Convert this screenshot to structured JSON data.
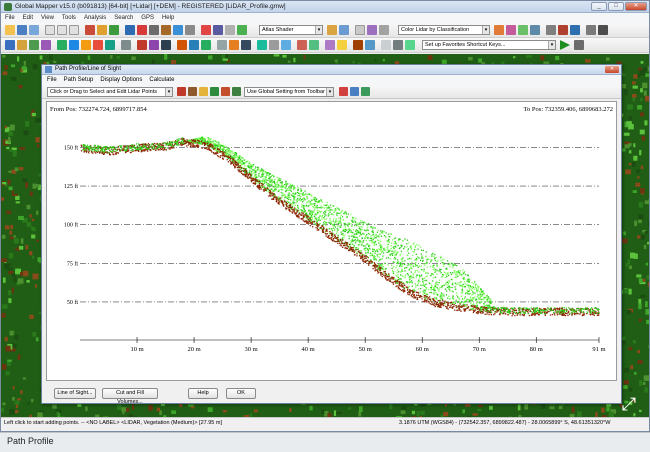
{
  "app": {
    "title": "Global Mapper v15.0 (b091813) [64-bit] [+Lidar] [+DEM] - REGISTERED [LiDAR_Profile.gmw]",
    "menu": [
      "File",
      "Edit",
      "View",
      "Tools",
      "Analysis",
      "Search",
      "GPS",
      "Help"
    ],
    "toolbar": {
      "shader_combo": "Atlas Shader",
      "color_combo": "Color Lidar by Classification",
      "favorites_combo": "Set up Favorites Shortcut Keys..."
    },
    "statusbar": {
      "left": "Left click to start adding points. -- <NO LABEL> <LIDAR, Vegetation (Medium)> [27.95 m]",
      "right": "3.1876  UTM (WGS84) - (732542.357, 6899822.487) - 28.0065899° S, 48.61351320°W"
    },
    "bottom_label": "Path Profile"
  },
  "dialog": {
    "title": "Path Profile/Line of Sight",
    "menu": [
      "File",
      "Path Setup",
      "Display Options",
      "Calculate"
    ],
    "tool_combo": "Click or Drag to Select and Edit Lidar Points",
    "setting_combo": "Use Global Setting from Toolbar",
    "from_pos": "From Pos: 732274.724, 6899717.854",
    "to_pos": "To Pos: 732359.406, 6899683.272",
    "buttons": {
      "line_of_sight": "Line of Sight...",
      "cut_fill": "Cut and Fill Volumes...",
      "help": "Help",
      "ok": "OK"
    }
  },
  "colors": {
    "ground": "#8b2500",
    "vegetation": "#2ecc1a",
    "vegetation_light": "#7cff5a",
    "grid": "#444444",
    "map_dark": "#1f5e14"
  },
  "chart_data": {
    "type": "scatter",
    "title": "",
    "xlabel": "",
    "ylabel": "",
    "xlim": [
      0,
      91
    ],
    "ylim": [
      37,
      160
    ],
    "x_ticks": [
      {
        "value": 10,
        "label": "10 m"
      },
      {
        "value": 20,
        "label": "20 m"
      },
      {
        "value": 30,
        "label": "30 m"
      },
      {
        "value": 40,
        "label": "40 m"
      },
      {
        "value": 50,
        "label": "50 m"
      },
      {
        "value": 60,
        "label": "60 m"
      },
      {
        "value": 70,
        "label": "70 m"
      },
      {
        "value": 80,
        "label": "80 m"
      },
      {
        "value": 91,
        "label": "91 m"
      }
    ],
    "y_ticks": [
      {
        "value": 50,
        "label": "50 ft"
      },
      {
        "value": 75,
        "label": "75 ft"
      },
      {
        "value": 100,
        "label": "100 ft"
      },
      {
        "value": 125,
        "label": "125 ft"
      },
      {
        "value": 150,
        "label": "150 ft"
      }
    ],
    "grid": "horizontal dash-dot",
    "series": [
      {
        "color": "#8b2500",
        "values": [
          [
            0,
            150
          ],
          [
            5,
            148
          ],
          [
            10,
            150
          ],
          [
            15,
            151
          ],
          [
            18,
            154
          ],
          [
            22,
            152
          ],
          [
            26,
            143
          ],
          [
            30,
            130
          ],
          [
            34,
            118
          ],
          [
            38,
            108
          ],
          [
            42,
            98
          ],
          [
            46,
            88
          ],
          [
            50,
            78
          ],
          [
            54,
            66
          ],
          [
            58,
            56
          ],
          [
            62,
            50
          ],
          [
            66,
            47
          ],
          [
            70,
            45
          ],
          [
            75,
            44
          ],
          [
            80,
            44
          ],
          [
            85,
            44
          ],
          [
            91,
            44
          ]
        ]
      },
      {
        "color": "#2ecc1a",
        "values": [
          [
            18,
            154
          ],
          [
            22,
            158
          ],
          [
            26,
            150
          ],
          [
            30,
            140
          ],
          [
            34,
            132
          ],
          [
            38,
            125
          ],
          [
            42,
            117
          ],
          [
            46,
            110
          ],
          [
            50,
            102
          ],
          [
            54,
            95
          ],
          [
            58,
            90
          ],
          [
            62,
            82
          ],
          [
            66,
            75
          ],
          [
            70,
            60
          ],
          [
            72,
            52
          ]
        ]
      }
    ]
  }
}
